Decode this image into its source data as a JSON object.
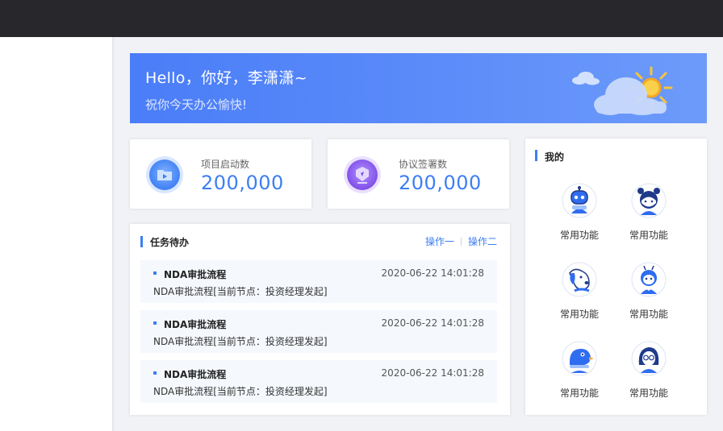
{
  "banner": {
    "title": "Hello，你好，李潇潇~",
    "subtitle": "祝你今天办公愉快!"
  },
  "stats": [
    {
      "label": "项目启动数",
      "value": "200,000",
      "icon": "folder-icon",
      "color": "#4e8cf6"
    },
    {
      "label": "协议签署数",
      "value": "200,000",
      "icon": "sign-icon",
      "color": "#8c5cf0"
    }
  ],
  "tasks": {
    "title": "任务待办",
    "actions": [
      "操作一",
      "操作二"
    ],
    "items": [
      {
        "title": "NDA审批流程",
        "time": "2020-06-22 14:01:28",
        "desc": "NDA审批流程[当前节点：投资经理发起]"
      },
      {
        "title": "NDA审批流程",
        "time": "2020-06-22 14:01:28",
        "desc": "NDA审批流程[当前节点：投资经理发起]"
      },
      {
        "title": "NDA审批流程",
        "time": "2020-06-22 14:01:28",
        "desc": "NDA审批流程[当前节点：投资经理发起]"
      }
    ]
  },
  "mine": {
    "title": "我的",
    "functions": [
      {
        "label": "常用功能",
        "icon": "robot-avatar-icon"
      },
      {
        "label": "常用功能",
        "icon": "girl-avatar-icon"
      },
      {
        "label": "常用功能",
        "icon": "dog-avatar-icon"
      },
      {
        "label": "常用功能",
        "icon": "bee-avatar-icon"
      },
      {
        "label": "常用功能",
        "icon": "bird-avatar-icon"
      },
      {
        "label": "常用功能",
        "icon": "glasses-girl-avatar-icon"
      }
    ]
  },
  "colors": {
    "accent": "#3d7ff4",
    "topbar": "#28282c",
    "banner": "#4a7df8"
  }
}
